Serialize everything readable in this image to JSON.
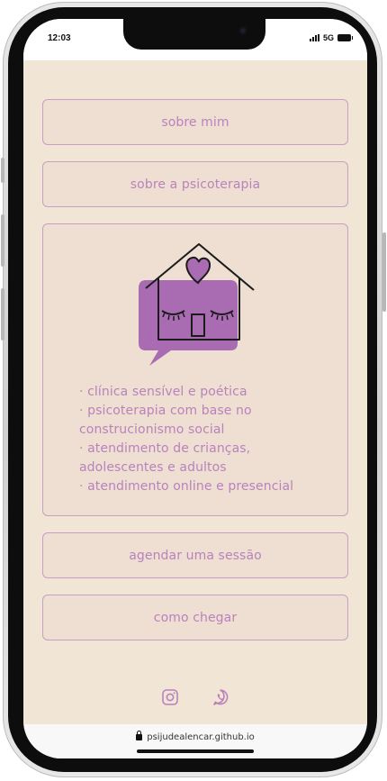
{
  "status_bar": {
    "time": "12:03",
    "network": "5G",
    "signal_icon": "signal-bars-icon",
    "battery_icon": "battery-icon"
  },
  "menu": {
    "about_me": "sobre mim",
    "about_psychotherapy": "sobre a psicoterapia",
    "schedule": "agendar uma sessão",
    "directions": "como chegar"
  },
  "panel": {
    "logo_icon": "house-speech-bubble-logo",
    "features": [
      "· clínica sensível e poética",
      "· psicoterapia com base no",
      "construcionismo social",
      "· atendimento de crianças,",
      "adolescentes e adultos",
      "· atendimento online e presencial"
    ]
  },
  "social": {
    "instagram_icon": "instagram-icon",
    "whatsapp_icon": "whatsapp-icon"
  },
  "browser": {
    "url": "psijudealencar.github.io",
    "lock_icon": "lock-icon"
  },
  "colors": {
    "background": "#f1e5d6",
    "button_fill": "#eedfd2",
    "accent": "#b982bd",
    "border": "#c79ec4",
    "logo_purple": "#a96cb3",
    "icon": "#b982bd"
  }
}
